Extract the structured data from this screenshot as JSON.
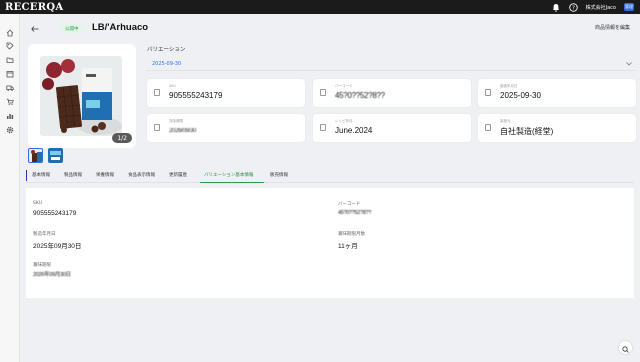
{
  "app": {
    "logo": "RECERQA",
    "company": "株式会社Jaco",
    "avatar_initials": "管理"
  },
  "header": {
    "status": "公開中",
    "title": "LB/'Arhuaco",
    "edit_label": "商品情報を編集"
  },
  "gallery": {
    "counter": "1/2"
  },
  "variation": {
    "label": "バリエーション",
    "selected": "2025-09-30",
    "cards": [
      {
        "label": "SKU",
        "value": "905555243179",
        "blurred": false
      },
      {
        "label": "バーコード",
        "value": "45?0??52?8??",
        "blurred": true
      },
      {
        "label": "製造年月日",
        "value": "2025-09-30",
        "blurred": false
      },
      {
        "label": "賞味期限",
        "value": "2026/09/30",
        "blurred": true
      },
      {
        "label": "レシピ年月",
        "value": "June.2024",
        "blurred": false
      },
      {
        "label": "製造元",
        "value": "自社製造(経堂)",
        "blurred": false
      }
    ]
  },
  "tabs": [
    "基本情報",
    "製品情報",
    "栄養情報",
    "食品表示情報",
    "更新履歴",
    "バリエーション基本情報",
    "販売情報"
  ],
  "details": {
    "sku_label": "SKU",
    "sku_value": "905555243179",
    "barcode_label": "バーコード",
    "barcode_value": "45?0??52?8??",
    "mfg_label": "製造年月日",
    "mfg_value": "2025年09月30日",
    "months_label": "賞味期限月数",
    "months_value": "11ヶ月",
    "expiry_label": "賞味期限",
    "expiry_value": "2026年09月30日"
  },
  "icons": {
    "topbar": [
      "bell-icon",
      "help-icon"
    ],
    "sidebar": [
      "home-icon",
      "tag-icon",
      "folder-icon",
      "box-icon",
      "truck-icon",
      "cart-icon",
      "chart-icon",
      "gear-icon"
    ]
  },
  "colors": {
    "accent_green": "#2a9a49",
    "accent_blue": "#2f6fe4",
    "topbar": "#1b1b1b"
  }
}
